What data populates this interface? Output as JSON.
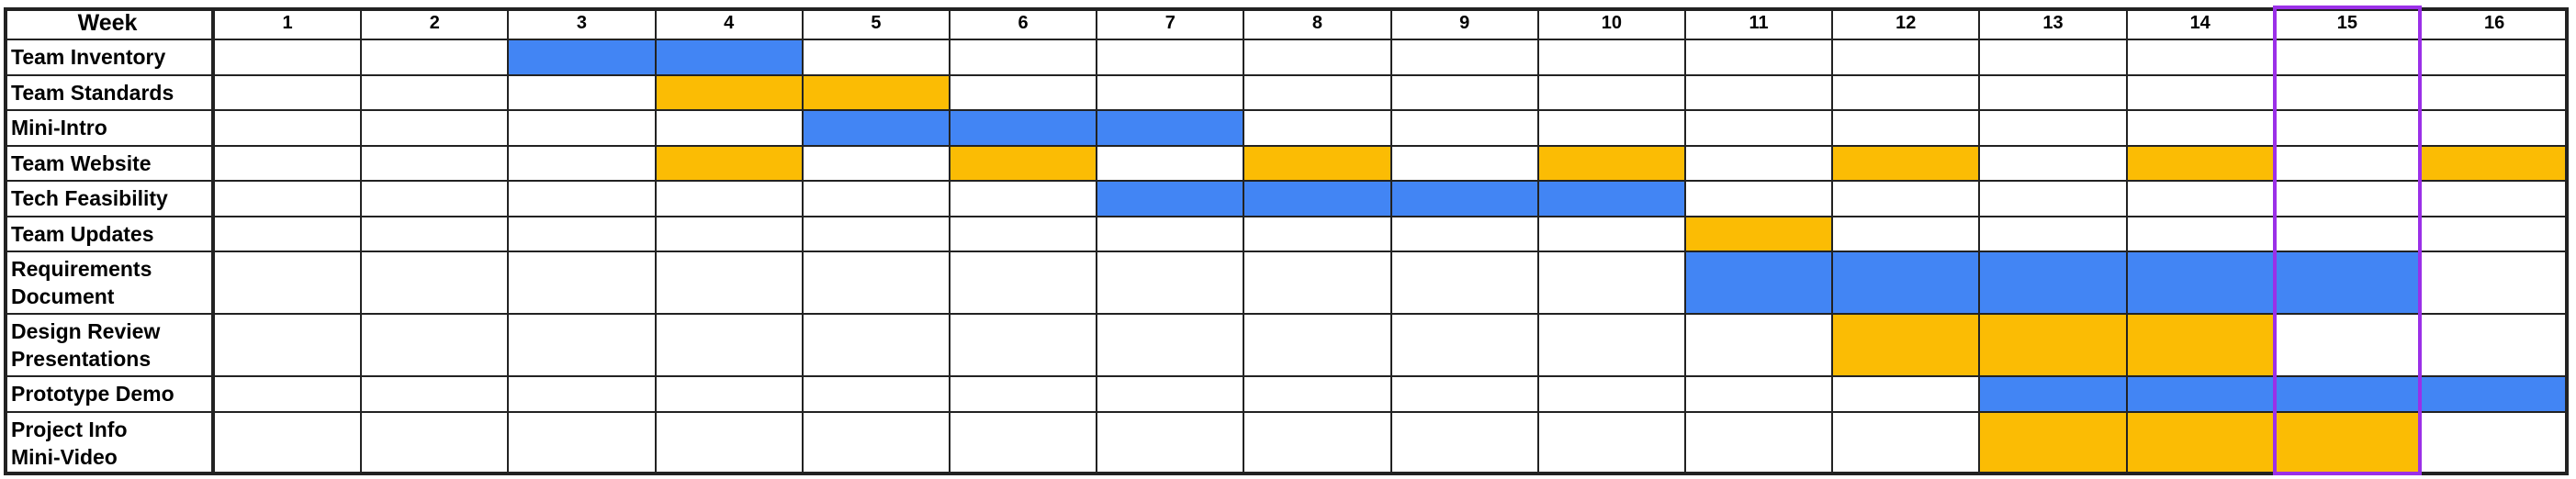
{
  "header": {
    "week_label": "Week",
    "weeks": [
      "1",
      "2",
      "3",
      "4",
      "5",
      "6",
      "7",
      "8",
      "9",
      "10",
      "11",
      "12",
      "13",
      "14",
      "15",
      "16"
    ]
  },
  "colors": {
    "blue": "#4285f4",
    "orange": "#fbbc04",
    "highlight": "#9b30e8"
  },
  "highlight_week": 15,
  "tasks": [
    {
      "label": "Team Inventory",
      "color": "blue",
      "weeks": [
        3,
        4
      ]
    },
    {
      "label": "Team Standards",
      "color": "orange",
      "weeks": [
        4,
        5
      ]
    },
    {
      "label": "Mini-Intro",
      "color": "blue",
      "weeks": [
        5,
        6,
        7
      ]
    },
    {
      "label": "Team Website",
      "color": "orange",
      "weeks": [
        4,
        6,
        8,
        10,
        12,
        14,
        16
      ]
    },
    {
      "label": "Tech Feasibility",
      "color": "blue",
      "weeks": [
        7,
        8,
        9,
        10
      ]
    },
    {
      "label": "Team Updates",
      "color": "orange",
      "weeks": [
        11
      ]
    },
    {
      "label": "Requirements\nDocument",
      "color": "blue",
      "weeks": [
        11,
        12,
        13,
        14,
        15
      ]
    },
    {
      "label": "Design Review\nPresentations",
      "color": "orange",
      "weeks": [
        12,
        13,
        14
      ]
    },
    {
      "label": "Prototype Demo",
      "color": "blue",
      "weeks": [
        13,
        14,
        15,
        16
      ]
    },
    {
      "label": "Project Info\nMini-Video",
      "color": "orange",
      "weeks": [
        13,
        14,
        15
      ]
    }
  ]
}
